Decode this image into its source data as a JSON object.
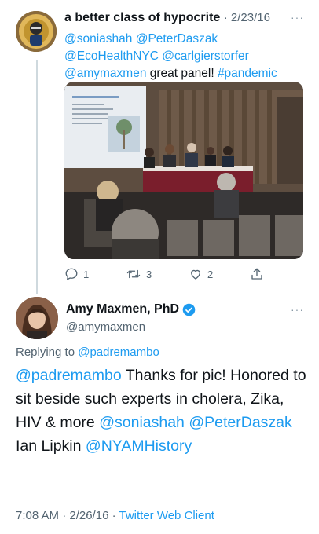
{
  "reply_tweet": {
    "display_name": "a better class of hypocrite",
    "date": "· 2/23/16",
    "more_label": "···",
    "text": {
      "m1": "@soniashah",
      "m2": "@PeterDaszak",
      "m3": "@EcoHealthNYC",
      "m4": "@carlgierstorfer",
      "m5": "@amymaxmen",
      "body": " great panel! ",
      "hashtag": "#pandemic"
    },
    "actions": {
      "replies": "1",
      "retweets": "3",
      "likes": "2"
    }
  },
  "main_tweet": {
    "display_name": "Amy Maxmen, PhD",
    "handle": "@amymaxmen",
    "more_label": "···",
    "replying_prefix": "Replying to ",
    "replying_to": "@padremambo",
    "text": {
      "m1": "@padremambo",
      "body1": " Thanks for pic! Honored to sit beside such experts in cholera, Zika, HIV & more ",
      "m2": "@soniashah",
      "m3": "@PeterDaszak",
      "body2": " Ian Lipkin ",
      "m4": "@NYAMHistory"
    },
    "time": "7:08 AM · 2/26/16 · ",
    "client": "Twitter Web Client"
  },
  "colors": {
    "link": "#1d9bf0",
    "verified": "#1d9bf0",
    "muted": "#536471"
  }
}
